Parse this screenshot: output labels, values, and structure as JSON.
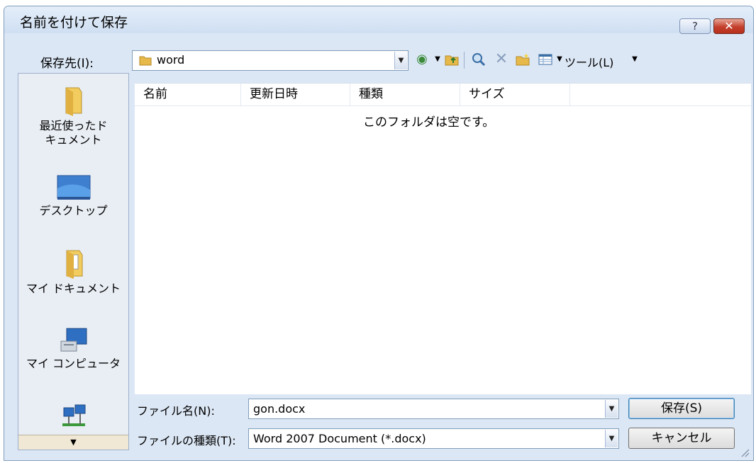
{
  "window": {
    "title": "名前を付けて保存",
    "help_label": "?",
    "close_label": "✕"
  },
  "toolbar": {
    "save_in_label": "保存先(I):",
    "save_in_value": "word",
    "tools_label": "ツール(L)"
  },
  "places": [
    {
      "label": "最近使ったドキュメント",
      "icon": "recent-folder-icon"
    },
    {
      "label": "デスクトップ",
      "icon": "desktop-icon"
    },
    {
      "label": "マイ ドキュメント",
      "icon": "documents-folder-icon"
    },
    {
      "label": "マイ コンピュータ",
      "icon": "computer-icon"
    }
  ],
  "file_list": {
    "columns": [
      "名前",
      "更新日時",
      "種類",
      "サイズ"
    ],
    "empty_message": "このフォルダは空です。"
  },
  "form": {
    "filename_label": "ファイル名(N):",
    "filename_value": "gon.docx",
    "filetype_label": "ファイルの種類(T):",
    "filetype_value": "Word 2007 Document (*.docx)",
    "save_button": "保存(S)",
    "cancel_button": "キャンセル"
  },
  "colors": {
    "frame": "#dce7f5",
    "close": "#c4402c",
    "accent": "#7f9db9"
  }
}
